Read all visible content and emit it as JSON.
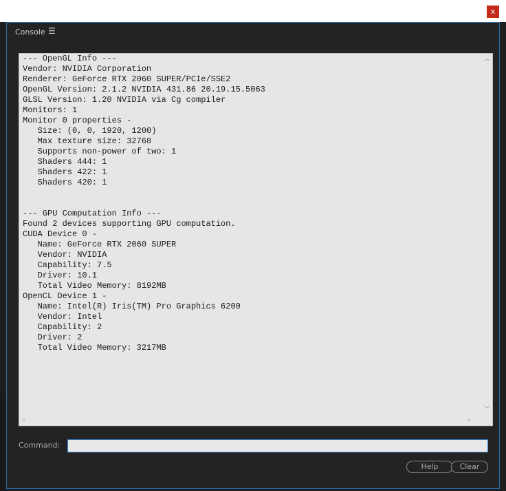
{
  "window": {
    "close_label": "x"
  },
  "panel": {
    "tab_label": "Console",
    "menu_icon": "hamburger-menu-icon"
  },
  "console": {
    "output": "--- OpenGL Info ---\nVendor: NVIDIA Corporation\nRenderer: GeForce RTX 2060 SUPER/PCIe/SSE2\nOpenGL Version: 2.1.2 NVIDIA 431.86 20.19.15.5063\nGLSL Version: 1.20 NVIDIA via Cg compiler\nMonitors: 1\nMonitor 0 properties -\n   Size: (0, 0, 1920, 1200)\n   Max texture size: 32768\n   Supports non-power of two: 1\n   Shaders 444: 1\n   Shaders 422: 1\n   Shaders 420: 1\n\n\n--- GPU Computation Info ---\nFound 2 devices supporting GPU computation.\nCUDA Device 0 -\n   Name: GeForce RTX 2060 SUPER\n   Vendor: NVIDIA\n   Capability: 7.5\n   Driver: 10.1\n   Total Video Memory: 8192MB\nOpenCL Device 1 -\n   Name: Intel(R) Iris(TM) Pro Graphics 6200\n   Vendor: Intel\n   Capability: 2\n   Driver: 2\n   Total Video Memory: 3217MB"
  },
  "command": {
    "label": "Command:",
    "value": ""
  },
  "buttons": {
    "help": "Help",
    "clear": "Clear"
  },
  "colors": {
    "accent": "#2b6ea8",
    "panel_bg": "#232323",
    "output_bg": "#e6e6e6",
    "close_red": "#c42b1c"
  }
}
